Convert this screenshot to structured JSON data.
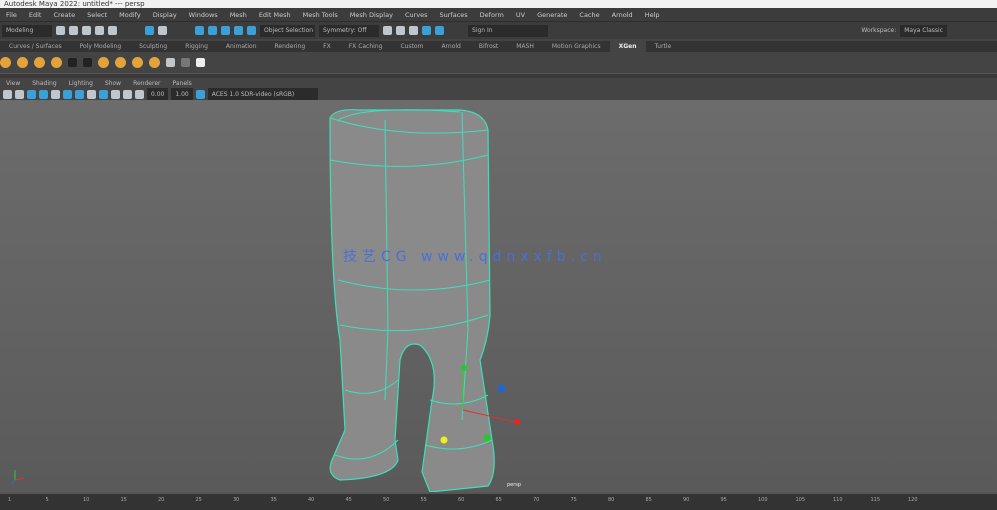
{
  "title": "Autodesk Maya 2022: untitled* --- persp",
  "menu": [
    "File",
    "Edit",
    "Create",
    "Select",
    "Modify",
    "Display",
    "Windows",
    "Mesh",
    "Edit Mesh",
    "Mesh Tools",
    "Mesh Display",
    "Curves",
    "Surfaces",
    "Deform",
    "UV",
    "Generate",
    "Cache",
    "Arnold",
    "Help"
  ],
  "status": {
    "menuset": "Modeling",
    "selection_field": "Object Selection",
    "symmetry": "Symmetry: Off",
    "user": "Sign In",
    "workspace_label": "Workspace:",
    "workspace": "Maya Classic"
  },
  "shelf_tabs": [
    "Curves / Surfaces",
    "Poly Modeling",
    "Sculpting",
    "Rigging",
    "Animation",
    "Rendering",
    "FX",
    "FX Caching",
    "Custom",
    "Arnold",
    "Bifrost",
    "MASH",
    "Motion Graphics",
    "XGen",
    "Turtle"
  ],
  "active_shelf_tab": "XGen",
  "panel_menu": [
    "View",
    "Shading",
    "Lighting",
    "Show",
    "Renderer",
    "Panels"
  ],
  "panel_toolbar": {
    "exposure": "0.00",
    "gamma": "1.00",
    "color_space": "ACES 1.0 SDR-video (sRGB)"
  },
  "viewport": {
    "camera": "persp",
    "watermark": "技艺CG www.qdnxxfb.cn",
    "wire_color": "#3de0b8"
  },
  "timeline": {
    "ticks": [
      "1",
      "5",
      "10",
      "15",
      "20",
      "25",
      "30",
      "35",
      "40",
      "45",
      "50",
      "55",
      "60",
      "65",
      "70",
      "75",
      "80",
      "85",
      "90",
      "95",
      "100",
      "105",
      "110",
      "115",
      "120"
    ]
  }
}
